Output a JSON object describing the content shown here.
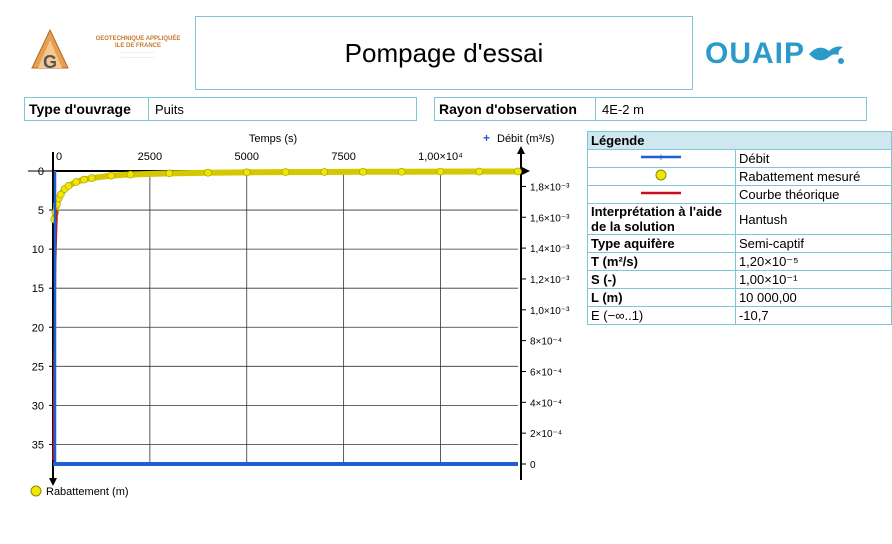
{
  "company": {
    "line1": "GEOTECHNIQUE APPLIQUÉE",
    "line2": "ILE DE FRANCE"
  },
  "title": "Pompage d'essai",
  "brand": "OUAIP",
  "ouvrage": {
    "label": "Type d'ouvrage",
    "value": "Puits"
  },
  "rayon": {
    "label": "Rayon d'observation",
    "value": "4E-2 m"
  },
  "legend": {
    "title": "Légende",
    "items": [
      {
        "label": "Débit",
        "color": "#1f5fd0"
      },
      {
        "label": "Rabattement mesuré",
        "color": "#f2e600"
      },
      {
        "label": "Courbe théorique",
        "color": "#c8101a"
      }
    ]
  },
  "params": [
    {
      "label": "Interprétation à l'aide de la solution",
      "value": "Hantush"
    },
    {
      "label": "Type aquifère",
      "value": "Semi-captif"
    },
    {
      "label": "T (m²/s)",
      "value": "1,20×10⁻⁵"
    },
    {
      "label": "S (-)",
      "value": "1,00×10⁻¹"
    },
    {
      "label": "L (m)",
      "value": "10 000,00"
    },
    {
      "label": "E (−∞..1)",
      "value": "-10,7"
    }
  ],
  "chart_data": {
    "type": "line",
    "xlabel": "Temps (s)",
    "ylabel": "Rabattement (m)",
    "y2label": "Débit (m³/s)",
    "x_ticks": [
      "0",
      "2500",
      "5000",
      "7500",
      "1,00×10⁴"
    ],
    "x_tick_values": [
      0,
      2500,
      5000,
      7500,
      10000
    ],
    "xlim": [
      0,
      12000
    ],
    "y_ticks": [
      "0",
      "5",
      "10",
      "15",
      "20",
      "25",
      "30",
      "35"
    ],
    "y_tick_values": [
      0,
      5,
      10,
      15,
      20,
      25,
      30,
      35
    ],
    "ylim": [
      0,
      37.5
    ],
    "y_inverted": true,
    "y2_ticks": [
      "0",
      "2×10⁻⁴",
      "4×10⁻⁴",
      "6×10⁻⁴",
      "8×10⁻⁴",
      "1,0×10⁻³",
      "1,2×10⁻³",
      "1,4×10⁻³",
      "1,6×10⁻³",
      "1,8×10⁻³"
    ],
    "y2_tick_values": [
      0,
      0.0002,
      0.0004,
      0.0006,
      0.0008,
      0.001,
      0.0012,
      0.0014,
      0.0016,
      0.0018
    ],
    "y2lim": [
      0,
      0.0019
    ],
    "series": [
      {
        "name": "Débit",
        "axis": "y2",
        "color": "#1f5fd0",
        "x": [
          0,
          12000
        ],
        "y": [
          0,
          0
        ]
      },
      {
        "name": "Rabattement mesuré",
        "axis": "y",
        "color": "#f2e600",
        "x": [
          30,
          60,
          100,
          150,
          200,
          300,
          400,
          600,
          800,
          1000,
          1500,
          2000,
          3000,
          4000,
          5000,
          6000,
          7000,
          8000,
          9000,
          10000,
          11000,
          12000
        ],
        "y": [
          6.2,
          5.3,
          4.3,
          3.5,
          3.0,
          2.3,
          1.9,
          1.4,
          1.1,
          0.9,
          0.6,
          0.45,
          0.3,
          0.22,
          0.17,
          0.14,
          0.12,
          0.1,
          0.09,
          0.08,
          0.07,
          0.06
        ]
      },
      {
        "name": "Courbe théorique",
        "axis": "y",
        "color": "#c8101a",
        "x": [
          10,
          30,
          60,
          100
        ],
        "y": [
          37.0,
          25.0,
          12.0,
          5.0
        ]
      }
    ]
  }
}
